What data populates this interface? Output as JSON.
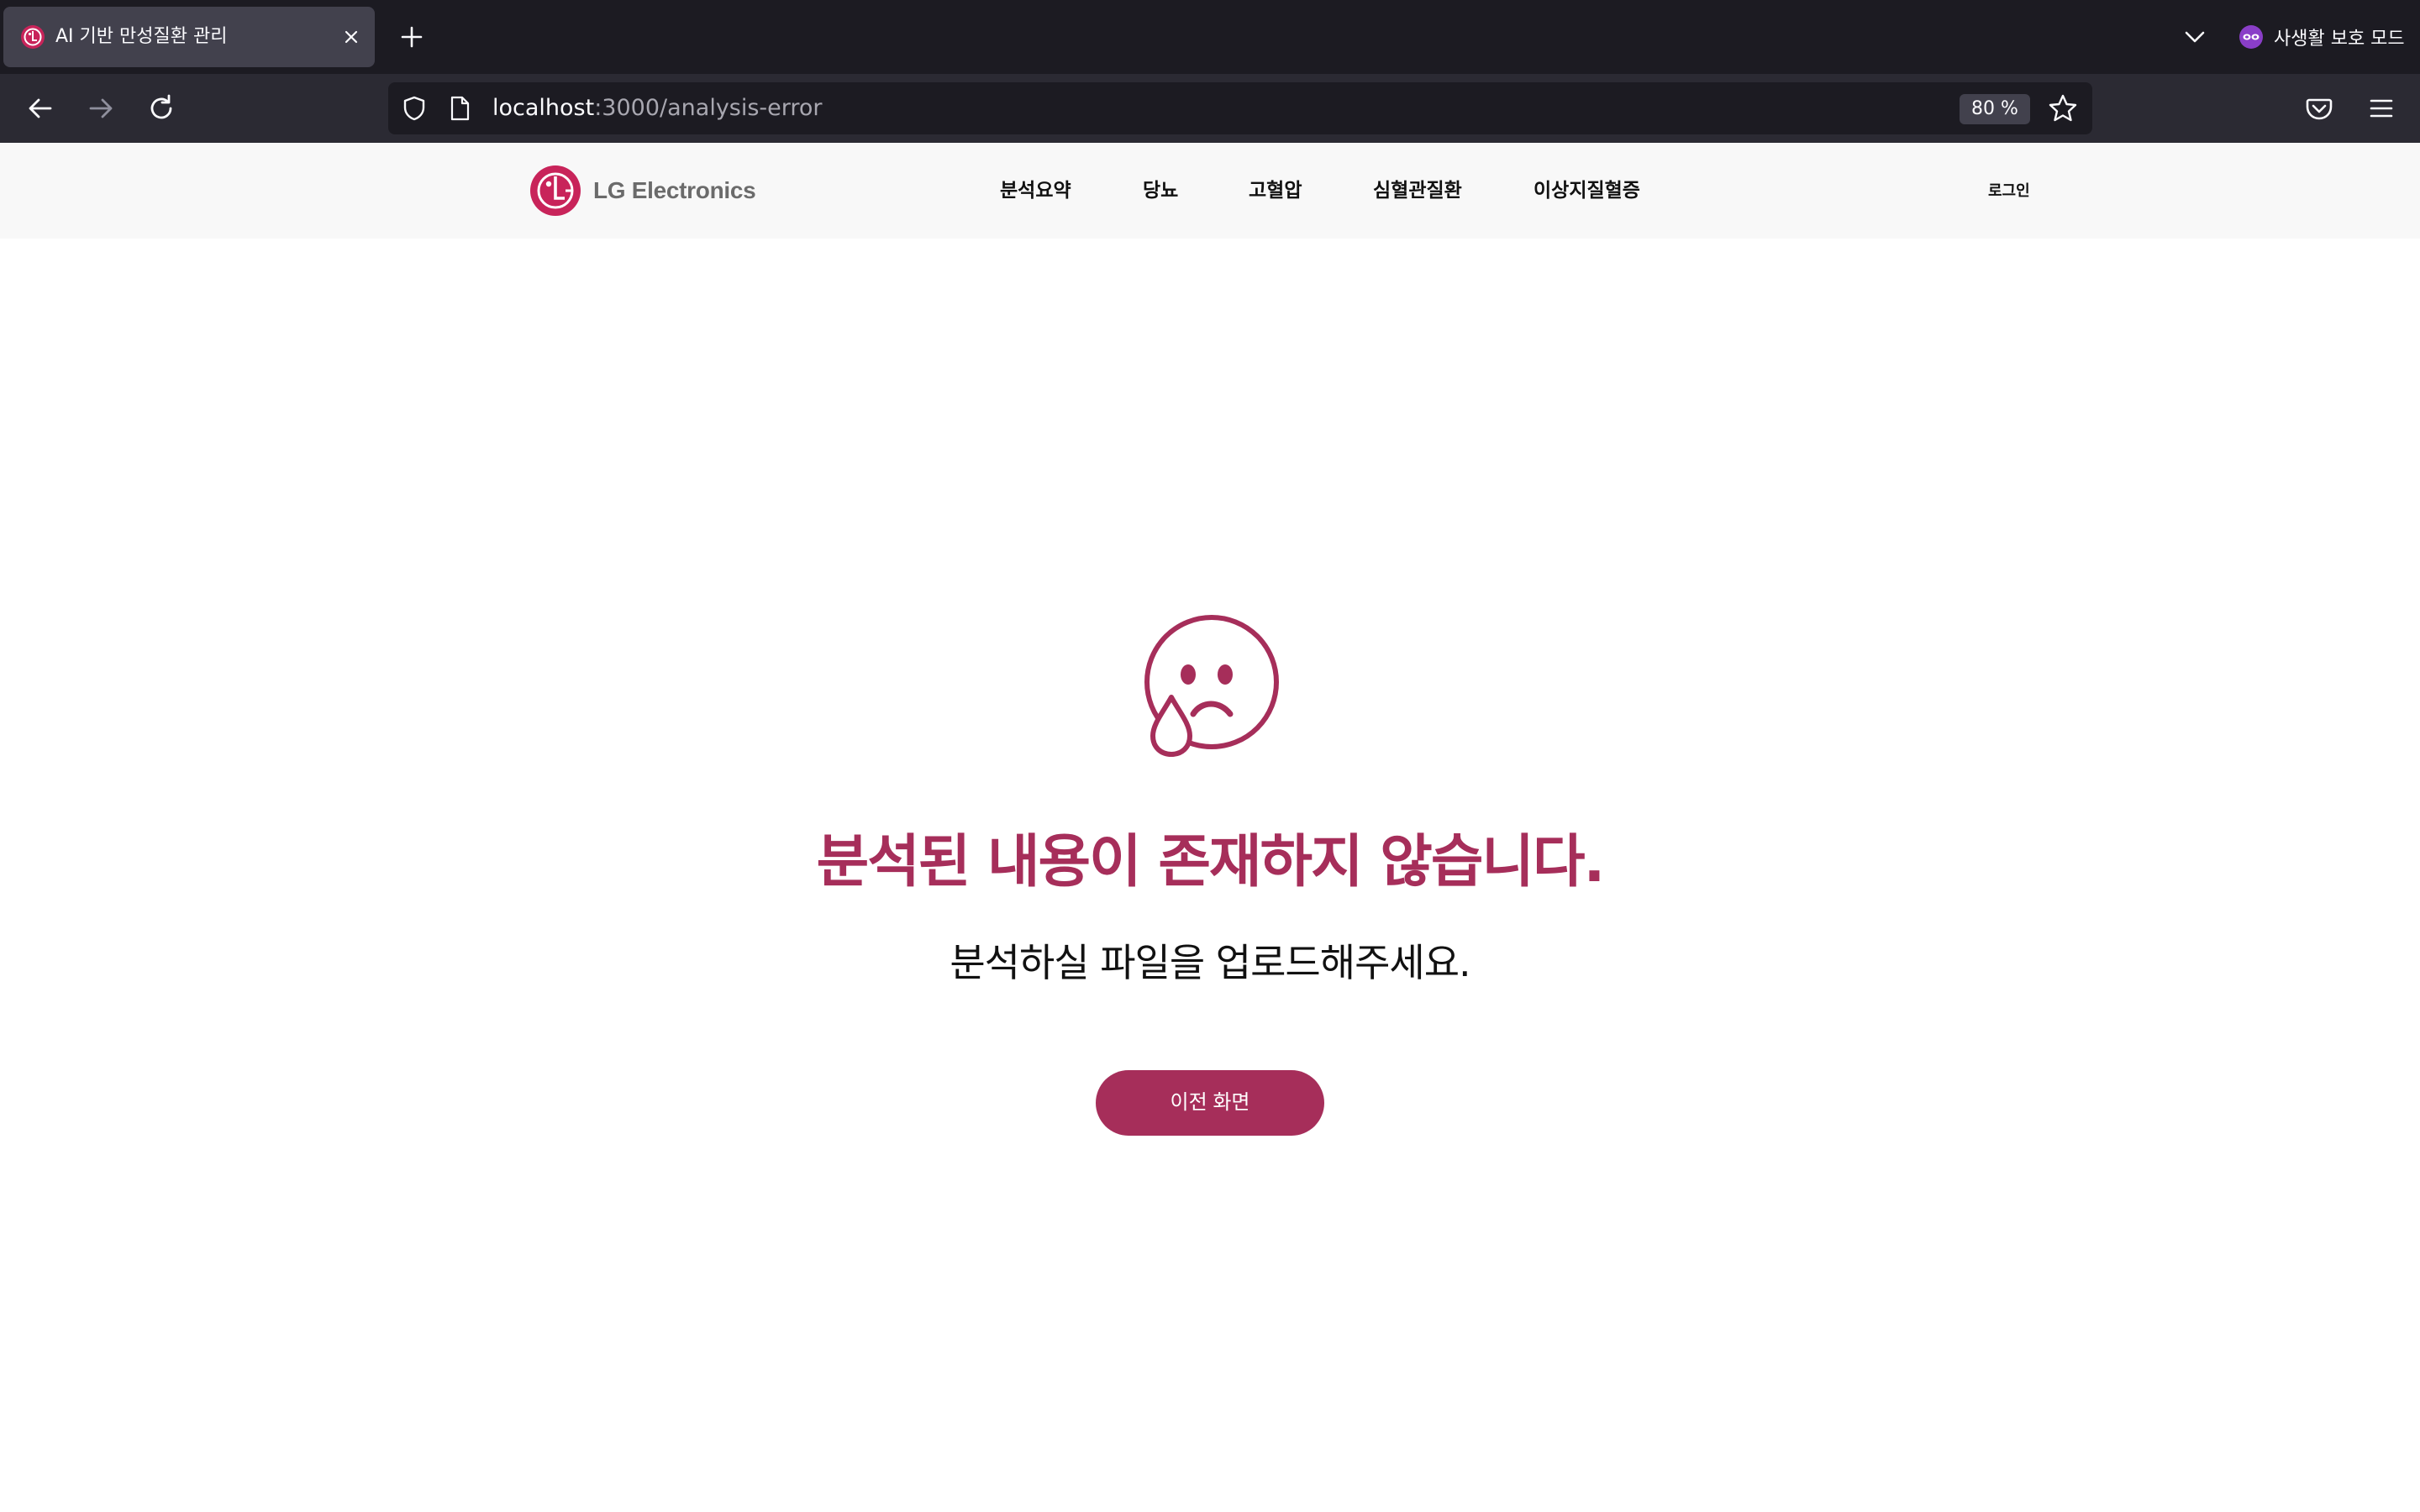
{
  "browser": {
    "tab_title": "AI 기반 만성질환 관리",
    "url_host": "localhost",
    "url_path": ":3000/analysis-error",
    "zoom": "80 %",
    "private_label": "사생활 보호 모드"
  },
  "header": {
    "brand": "LG Electronics",
    "menu": [
      "분석요약",
      "당뇨",
      "고혈압",
      "심혈관질환",
      "이상지질혈증"
    ],
    "login": "로그인"
  },
  "main": {
    "title": "분석된 내용이 존재하지 않습니다.",
    "subtitle": "분석하실 파일을 업로드해주세요.",
    "button_label": "이전 화면"
  },
  "colors": {
    "accent": "#a62e5a",
    "chrome_dark": "#1c1b22",
    "chrome_toolbar": "#2b2a33",
    "header_bg": "#f8f8f8"
  },
  "icons": [
    "lg-favicon-icon",
    "close-icon",
    "plus-icon",
    "chevron-down-icon",
    "private-browsing-icon",
    "back-arrow-icon",
    "forward-arrow-icon",
    "reload-icon",
    "shield-icon",
    "page-icon",
    "star-icon",
    "pocket-icon",
    "hamburger-menu-icon",
    "lg-logo-icon",
    "sad-face-icon"
  ]
}
